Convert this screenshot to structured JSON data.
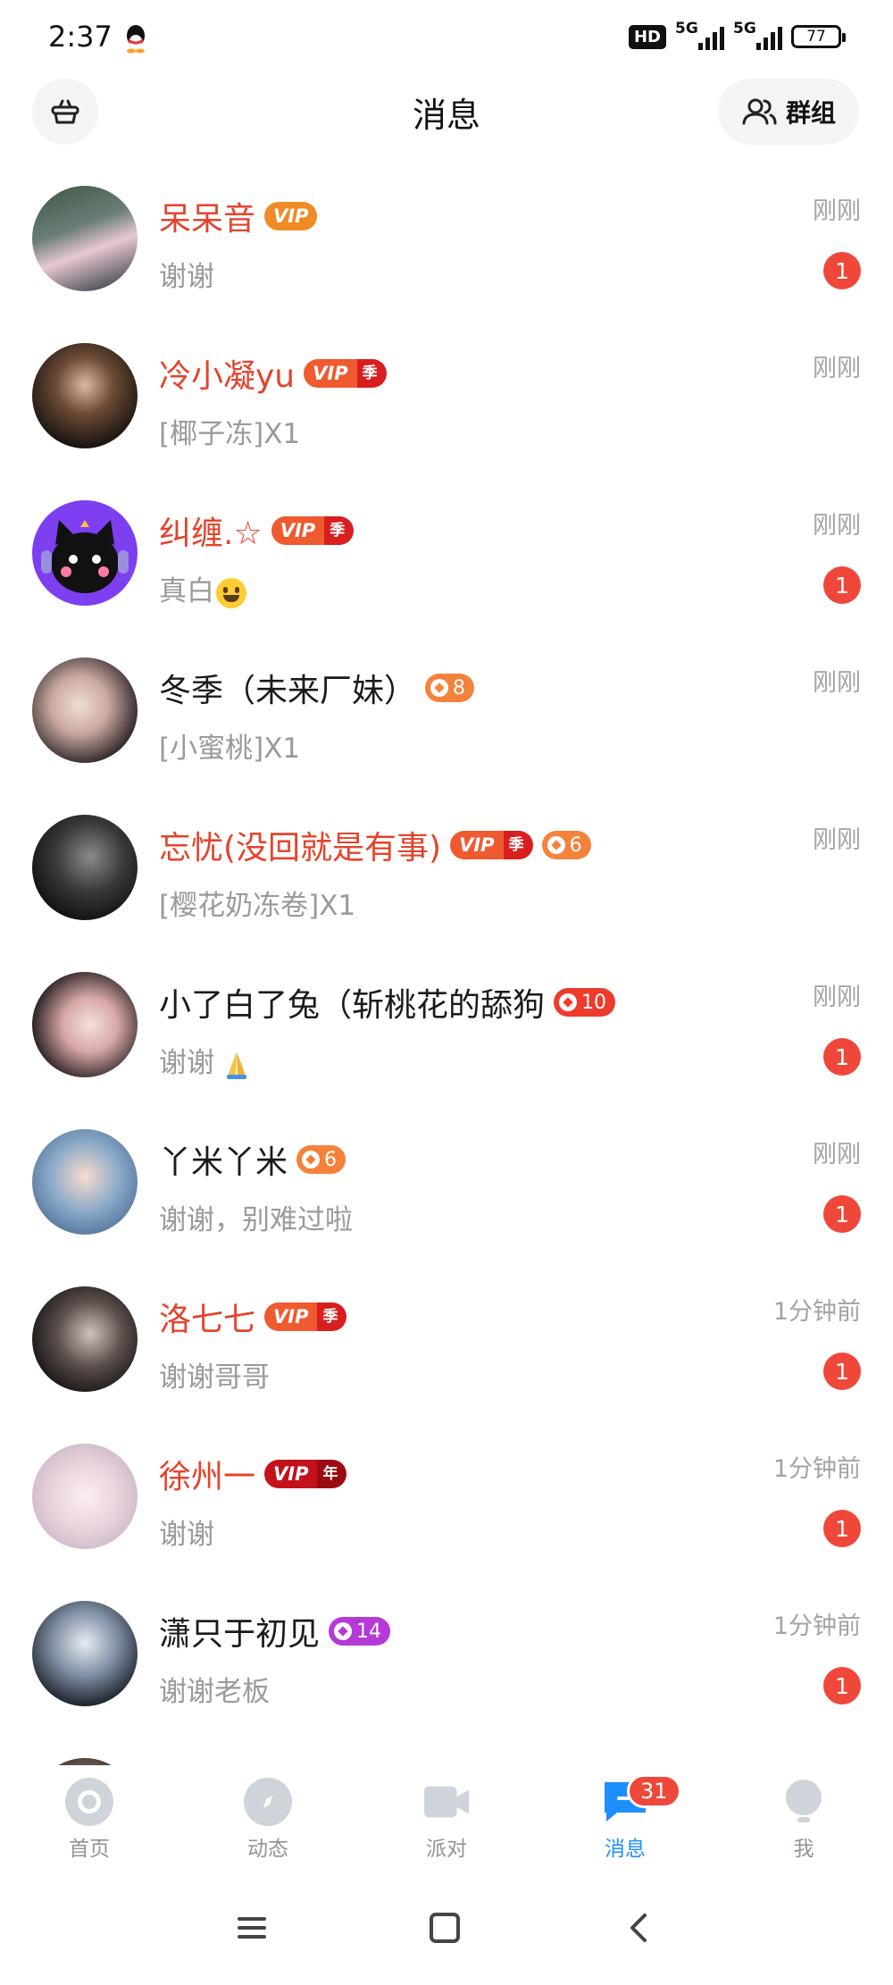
{
  "status_bar": {
    "time": "2:37",
    "battery": "77",
    "net1": "5G",
    "net2": "5G",
    "hd": "HD"
  },
  "header": {
    "title": "消息",
    "group_label": "群组"
  },
  "conversations": [
    {
      "name": "呆呆音",
      "vip": true,
      "preview": "谢谢",
      "time": "刚刚",
      "unread": "1"
    },
    {
      "name": "冷小凝yu",
      "vip": true,
      "badge_tier": "季",
      "preview": "[椰子冻]X1",
      "time": "刚刚"
    },
    {
      "name": "纠缠.☆",
      "vip": true,
      "badge_tier": "季",
      "preview": "真白",
      "time": "刚刚",
      "unread": "1"
    },
    {
      "name": "冬季（未来厂妹）",
      "level": "8",
      "preview": "[小蜜桃]X1",
      "time": "刚刚"
    },
    {
      "name": "忘忧(没回就是有事)",
      "vip": true,
      "badge_tier": "季",
      "level": "6",
      "preview": "[樱花奶冻卷]X1",
      "time": "刚刚"
    },
    {
      "name": "小了白了兔（斩桃花的舔狗",
      "level": "10",
      "preview": "谢谢",
      "time": "刚刚",
      "unread": "1"
    },
    {
      "name": "丫米丫米",
      "level": "6",
      "preview": "谢谢，别难过啦",
      "time": "刚刚",
      "unread": "1"
    },
    {
      "name": "洛七七",
      "vip": true,
      "badge_tier": "季",
      "preview": "谢谢哥哥",
      "time": "1分钟前",
      "unread": "1"
    },
    {
      "name": "徐州一",
      "vip": true,
      "badge_tier": "年",
      "preview": "谢谢",
      "time": "1分钟前",
      "unread": "1"
    },
    {
      "name": "潇只于初见",
      "level": "14",
      "preview": "谢谢老板",
      "time": "1分钟前",
      "unread": "1"
    }
  ],
  "vip_badge_text": "VIP",
  "tabs": [
    {
      "label": "首页"
    },
    {
      "label": "动态"
    },
    {
      "label": "派对"
    },
    {
      "label": "消息",
      "badge": "31"
    },
    {
      "label": "我"
    }
  ],
  "colors": {
    "vip_name": "#e4432b",
    "unread": "#f0473b",
    "active_tab": "#1d8fff"
  }
}
